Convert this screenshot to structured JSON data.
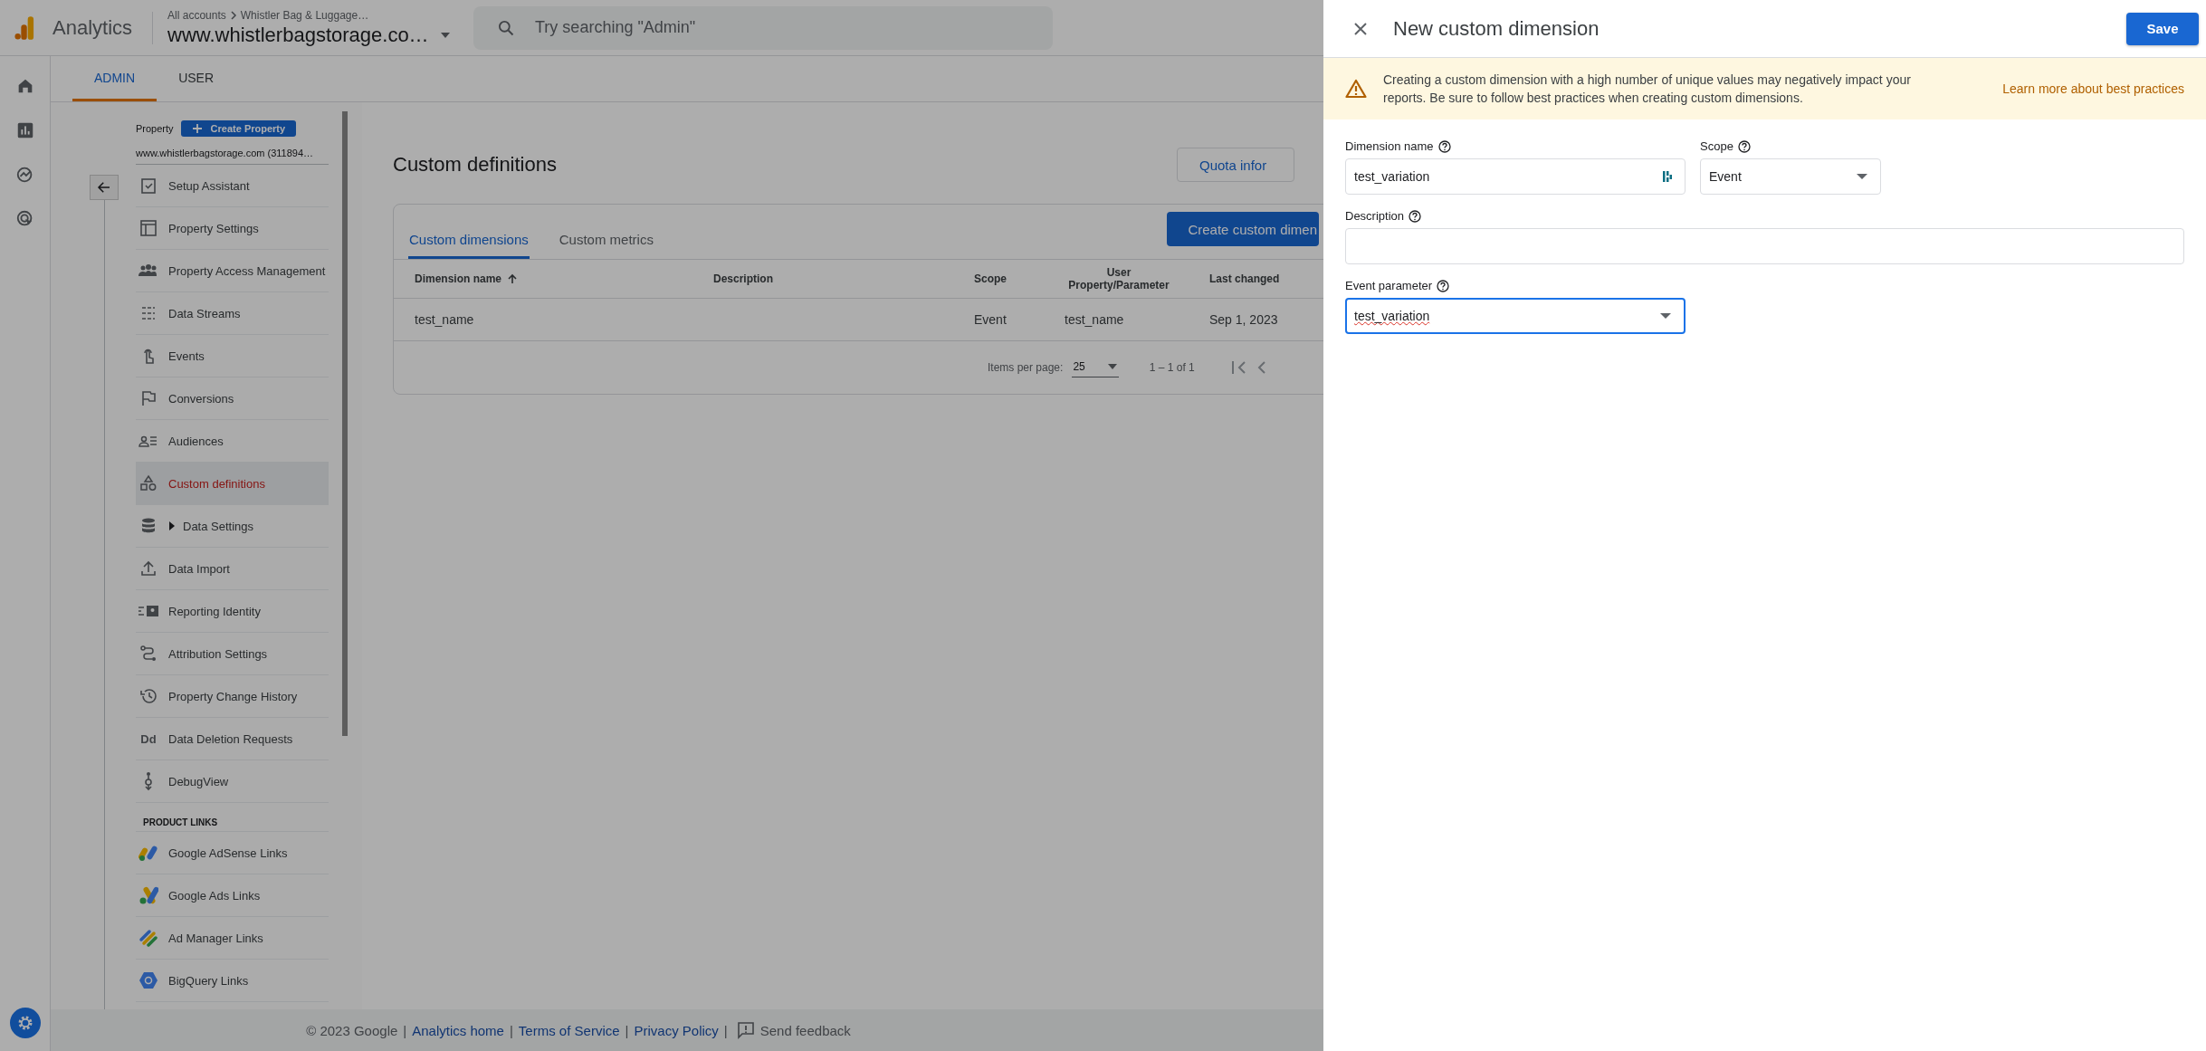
{
  "header": {
    "product": "Analytics",
    "breadcrumb": [
      "All accounts",
      "Whistler Bag & Luggage…"
    ],
    "property": "www.whistlerbagstorage.co…",
    "search_placeholder": "Try searching \"Admin\""
  },
  "admin_tabs": [
    {
      "label": "ADMIN",
      "selected": true
    },
    {
      "label": "USER",
      "selected": false
    }
  ],
  "property": {
    "label": "Property",
    "create_button": "Create Property",
    "name": "www.whistlerbagstorage.com (311894…"
  },
  "nav": [
    {
      "label": "Setup Assistant",
      "kind": "link",
      "selected": false
    },
    {
      "label": "Property Settings",
      "kind": "link",
      "selected": false
    },
    {
      "label": "Property Access Management",
      "kind": "link",
      "selected": false
    },
    {
      "label": "Data Streams",
      "kind": "link",
      "selected": false
    },
    {
      "label": "Events",
      "kind": "link",
      "selected": false
    },
    {
      "label": "Conversions",
      "kind": "link",
      "selected": false
    },
    {
      "label": "Audiences",
      "kind": "link",
      "selected": false
    },
    {
      "label": "Custom definitions",
      "kind": "link",
      "selected": true
    },
    {
      "label": "Data Settings",
      "kind": "group",
      "selected": false
    },
    {
      "label": "Data Import",
      "kind": "link",
      "selected": false
    },
    {
      "label": "Reporting Identity",
      "kind": "link",
      "selected": false
    },
    {
      "label": "Attribution Settings",
      "kind": "link",
      "selected": false
    },
    {
      "label": "Property Change History",
      "kind": "link",
      "selected": false
    },
    {
      "label": "Data Deletion Requests",
      "kind": "link",
      "selected": false,
      "glyph": "Dd"
    },
    {
      "label": "DebugView",
      "kind": "link",
      "selected": false
    }
  ],
  "product_links": {
    "heading": "PRODUCT LINKS",
    "items": [
      {
        "label": "Google AdSense Links"
      },
      {
        "label": "Google Ads Links"
      },
      {
        "label": "Ad Manager Links"
      },
      {
        "label": "BigQuery Links"
      }
    ]
  },
  "main": {
    "title": "Custom definitions",
    "quota_button": "Quota infor",
    "tabs": [
      {
        "label": "Custom dimensions",
        "selected": true
      },
      {
        "label": "Custom metrics",
        "selected": false
      }
    ],
    "create_button": "Create custom dimen",
    "table": {
      "columns": [
        {
          "label": "Dimension name",
          "sorted": true
        },
        {
          "label": "Description",
          "sorted": false
        },
        {
          "label": "Scope",
          "sorted": false
        },
        {
          "label": "User Property/Parameter",
          "sorted": false
        },
        {
          "label": "Last changed",
          "sorted": false
        }
      ],
      "rows": [
        {
          "dimension_name": "test_name",
          "scope": "Event",
          "parameter": "test_name",
          "last_changed": "Sep 1, 2023"
        }
      ]
    },
    "pagination": {
      "label": "Items per page:",
      "page_size": "25",
      "range": "1 – 1 of 1"
    }
  },
  "footer": [
    {
      "kind": "text",
      "text": "© 2023 Google"
    },
    {
      "kind": "sep",
      "text": "|"
    },
    {
      "kind": "link",
      "text": "Analytics home"
    },
    {
      "kind": "sep",
      "text": "|"
    },
    {
      "kind": "link",
      "text": "Terms of Service"
    },
    {
      "kind": "sep",
      "text": "|"
    },
    {
      "kind": "link",
      "text": "Privacy Policy"
    },
    {
      "kind": "sep",
      "text": "|"
    },
    {
      "kind": "feedback",
      "text": "Send feedback"
    }
  ],
  "panel": {
    "title": "New custom dimension",
    "save_button": "Save",
    "warning": {
      "text": "Creating a custom dimension with a high number of unique values may negatively impact your reports. Be sure to follow best practices when creating custom dimensions.",
      "link": "Learn more about best practices"
    },
    "fields": [
      {
        "kind": "text",
        "label": "Dimension name",
        "value": "test_variation",
        "focused": false
      },
      {
        "kind": "select",
        "label": "Scope",
        "value": "Event",
        "focused": false
      },
      {
        "kind": "text",
        "label": "Description",
        "focused": false
      },
      {
        "kind": "select",
        "label": "Event parameter",
        "value": "test_variation",
        "focused": true,
        "misspelled": true
      }
    ]
  }
}
